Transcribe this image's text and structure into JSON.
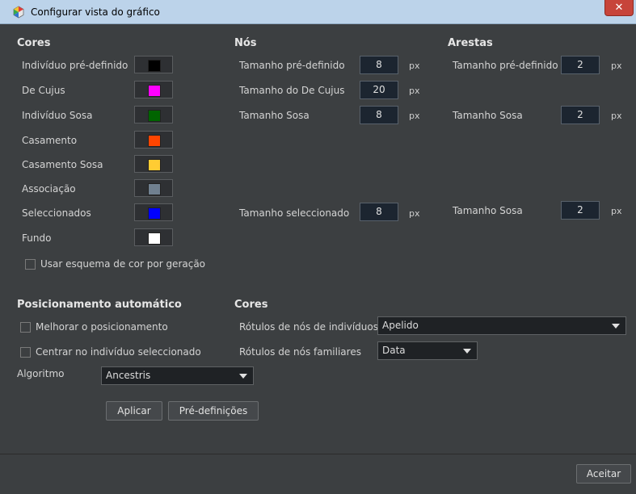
{
  "window": {
    "title": "Configurar vista do gráfico",
    "close_symbol": "✕"
  },
  "colors_section": {
    "heading": "Cores",
    "items": [
      {
        "label": "Indivíduo pré-definido",
        "color": "#000000"
      },
      {
        "label": "De Cujus",
        "color": "#ff00ff"
      },
      {
        "label": "Indivíduo Sosa",
        "color": "#006400"
      },
      {
        "label": "Casamento",
        "color": "#ff4500"
      },
      {
        "label": "Casamento Sosa",
        "color": "#ffcc33"
      },
      {
        "label": "Associação",
        "color": "#708090"
      },
      {
        "label": "Seleccionados",
        "color": "#0000ff"
      },
      {
        "label": "Fundo",
        "color": "#ffffff"
      }
    ],
    "generation_scheme_label": "Usar esquema de cor por geração",
    "generation_scheme_checked": false
  },
  "nodes_section": {
    "heading": "Nós",
    "default_size": {
      "label": "Tamanho pré-definido",
      "value": "8",
      "unit": "px"
    },
    "decujus_size": {
      "label": "Tamanho do De Cujus",
      "value": "20",
      "unit": "px"
    },
    "sosa_size": {
      "label": "Tamanho Sosa",
      "value": "8",
      "unit": "px"
    },
    "selected_size": {
      "label": "Tamanho seleccionado",
      "value": "8",
      "unit": "px"
    }
  },
  "edges_section": {
    "heading": "Arestas",
    "default_size": {
      "label": "Tamanho pré-definido",
      "value": "2",
      "unit": "px"
    },
    "sosa_size": {
      "label": "Tamanho Sosa",
      "value": "2",
      "unit": "px"
    },
    "selected_sosa_size": {
      "label": "Tamanho Sosa",
      "value": "2",
      "unit": "px"
    }
  },
  "autolayout_section": {
    "heading": "Posicionamento automático",
    "improve_label": "Melhorar o posicionamento",
    "improve_checked": false,
    "center_label": "Centrar no indivíduo seleccionado",
    "center_checked": false,
    "algorithm_label": "Algoritmo",
    "algorithm_value": "Ancestris",
    "apply_button": "Aplicar",
    "defaults_button": "Pré-definições"
  },
  "labels_section": {
    "heading": "Cores",
    "individual_label": "Rótulos de nós de indivíduos",
    "individual_value": "Apelido",
    "family_label": "Rótulos de nós familiares",
    "family_value": "Data"
  },
  "footer": {
    "accept_button": "Aceitar"
  }
}
